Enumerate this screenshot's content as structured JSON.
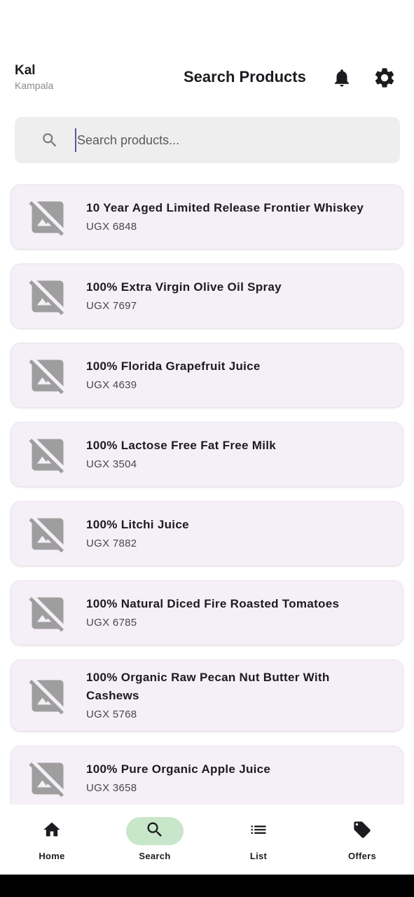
{
  "header": {
    "user_name": "Kal",
    "user_city": "Kampala",
    "title": "Search Products",
    "icons": [
      "bell-icon",
      "gear-icon"
    ]
  },
  "search": {
    "placeholder": "Search products...",
    "value": ""
  },
  "products": [
    {
      "name": "10 Year Aged Limited Release Frontier Whiskey",
      "price": "UGX 6848"
    },
    {
      "name": "100% Extra Virgin Olive Oil Spray",
      "price": "UGX 7697"
    },
    {
      "name": "100% Florida Grapefruit Juice",
      "price": "UGX 4639"
    },
    {
      "name": "100% Lactose Free Fat Free Milk",
      "price": "UGX 3504"
    },
    {
      "name": "100% Litchi Juice",
      "price": "UGX 7882"
    },
    {
      "name": "100% Natural Diced Fire Roasted Tomatoes",
      "price": "UGX 6785"
    },
    {
      "name": "100% Organic Raw Pecan Nut Butter With Cashews",
      "price": "UGX 5768"
    },
    {
      "name": "100% Pure Organic Apple Juice",
      "price": "UGX 3658"
    }
  ],
  "nav": {
    "items": [
      {
        "label": "Home",
        "icon": "home-icon"
      },
      {
        "label": "Search",
        "icon": "search-icon",
        "active": true
      },
      {
        "label": "List",
        "icon": "list-icon"
      },
      {
        "label": "Offers",
        "icon": "tag-icon"
      }
    ]
  },
  "colors": {
    "card_bg": "#f5eff7",
    "active_nav_pill": "#c8e6c9",
    "search_bg": "#eeeeee",
    "caret": "#6750a4"
  }
}
